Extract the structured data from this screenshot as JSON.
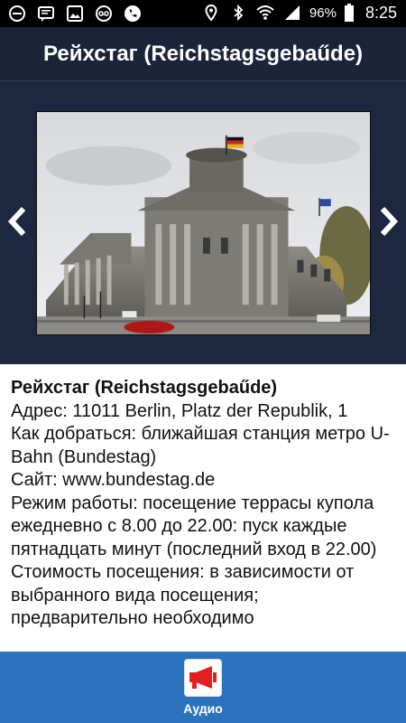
{
  "status_bar": {
    "battery": "96%",
    "time": "8:25",
    "icons": [
      "minus-circle-icon",
      "message-icon",
      "image-icon",
      "voicemail-icon",
      "phone-icon",
      "location-icon",
      "bluetooth-icon",
      "wifi-icon",
      "signal-icon",
      "battery-icon"
    ]
  },
  "header": {
    "title": "Рейхстаг  (Reichstagsgebaűde)"
  },
  "gallery": {
    "prev_icon": "chevron-left-icon",
    "next_icon": "chevron-right-icon"
  },
  "info": {
    "title": "Рейхстаг  (Reichstagsgebaűde)",
    "lines": [
      "Адрес: 11011 Berlin, Platz der Republik, 1",
      "Как добраться: ближайшая станция метро U-Bahn (Bundestag)",
      "Сайт: www.bundestag.de",
      "Режим работы: посещение террасы купола ежедневно с 8.00 до 22.00: пуск каждые пятнадцать минут (последний вход в 22.00)",
      "Стоимость посещения: в зависимости от выбранного вида посещения; предварительно необходимо"
    ]
  },
  "bottom_bar": {
    "audio_label": "Аудио",
    "audio_icon": "megaphone-icon",
    "accent_color": "#2b74bd"
  }
}
